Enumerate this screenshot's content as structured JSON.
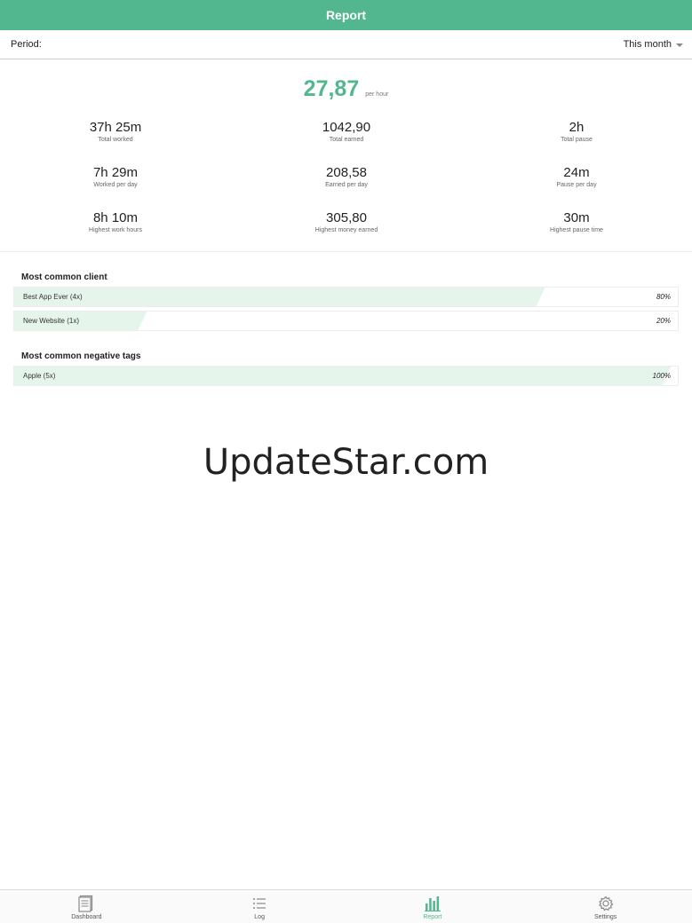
{
  "header": {
    "title": "Report"
  },
  "period": {
    "label": "Period:",
    "selected": "This month"
  },
  "rate": {
    "value": "27,87",
    "unit": "per hour"
  },
  "stats": [
    {
      "value": "37h 25m",
      "label": "Total worked"
    },
    {
      "value": "1042,90",
      "label": "Total earned"
    },
    {
      "value": "2h",
      "label": "Total pause"
    },
    {
      "value": "7h 29m",
      "label": "Worked per day"
    },
    {
      "value": "208,58",
      "label": "Earned per day"
    },
    {
      "value": "24m",
      "label": "Pause per day"
    },
    {
      "value": "8h 10m",
      "label": "Highest work hours"
    },
    {
      "value": "305,80",
      "label": "Highest money earned"
    },
    {
      "value": "30m",
      "label": "Highest pause time"
    }
  ],
  "clients": {
    "title": "Most common client",
    "items": [
      {
        "label": "Best App Ever (4x)",
        "percent_text": "80%",
        "fraction": 0.8
      },
      {
        "label": "New Website (1x)",
        "percent_text": "20%",
        "fraction": 0.2
      }
    ]
  },
  "negative_tags": {
    "title": "Most common negative tags",
    "items": [
      {
        "label": "Apple (5x)",
        "percent_text": "100%",
        "fraction": 1.0
      }
    ]
  },
  "watermark": "UpdateStar.com",
  "nav": {
    "items": [
      {
        "label": "Dashboard",
        "icon": "dashboard-icon",
        "active": false
      },
      {
        "label": "Log",
        "icon": "list-icon",
        "active": false
      },
      {
        "label": "Report",
        "icon": "bar-chart-icon",
        "active": true
      },
      {
        "label": "Settings",
        "icon": "gear-icon",
        "active": false
      }
    ]
  },
  "colors": {
    "accent": "#52b78e",
    "bar_fill": "#e6f5ec"
  }
}
